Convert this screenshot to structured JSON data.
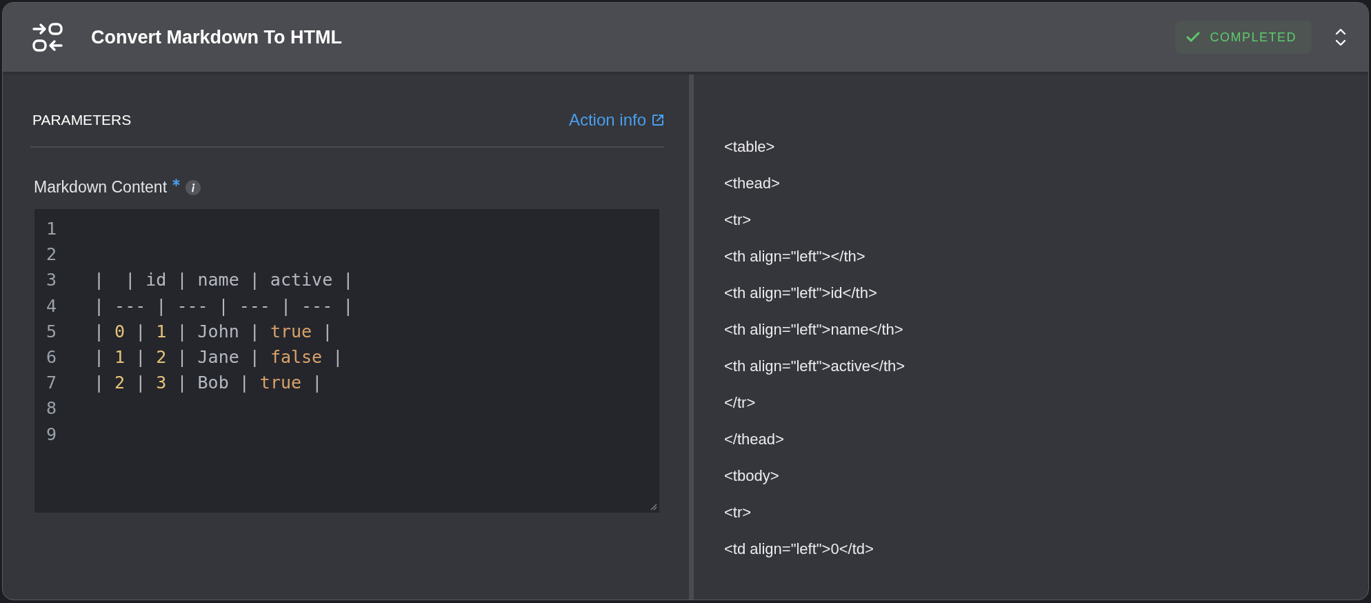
{
  "header": {
    "title": "Convert Markdown To HTML",
    "status": {
      "label": "COMPLETED",
      "kind": "completed"
    }
  },
  "parameters": {
    "heading": "PARAMETERS",
    "link": "Action info",
    "field": {
      "label": "Markdown Content",
      "required": true,
      "lines": [
        {
          "number": "1"
        },
        {
          "number": "2"
        },
        {
          "number": "3",
          "tokens": [
            {
              "kind": "plain",
              "text": "|  | id | name | active |"
            }
          ]
        },
        {
          "number": "4",
          "tokens": [
            {
              "kind": "plain",
              "text": "| --- | --- | --- | --- |"
            }
          ]
        },
        {
          "number": "5",
          "tokens": [
            {
              "kind": "plain",
              "text": "| "
            },
            {
              "kind": "number",
              "text": "0"
            },
            {
              "kind": "plain",
              "text": " | "
            },
            {
              "kind": "number",
              "text": "1"
            },
            {
              "kind": "plain",
              "text": " | John | "
            },
            {
              "kind": "keyword",
              "text": "true"
            },
            {
              "kind": "plain",
              "text": " |"
            }
          ]
        },
        {
          "number": "6",
          "tokens": [
            {
              "kind": "plain",
              "text": "| "
            },
            {
              "kind": "number",
              "text": "1"
            },
            {
              "kind": "plain",
              "text": " | "
            },
            {
              "kind": "number",
              "text": "2"
            },
            {
              "kind": "plain",
              "text": " | Jane | "
            },
            {
              "kind": "keyword",
              "text": "false"
            },
            {
              "kind": "plain",
              "text": " |"
            }
          ]
        },
        {
          "number": "7",
          "tokens": [
            {
              "kind": "plain",
              "text": "| "
            },
            {
              "kind": "number",
              "text": "2"
            },
            {
              "kind": "plain",
              "text": " | "
            },
            {
              "kind": "number",
              "text": "3"
            },
            {
              "kind": "plain",
              "text": " | Bob | "
            },
            {
              "kind": "keyword",
              "text": "true"
            },
            {
              "kind": "plain",
              "text": " |"
            }
          ]
        },
        {
          "number": "8"
        },
        {
          "number": "9"
        }
      ]
    }
  },
  "output": {
    "lines": [
      "<table>",
      "<thead>",
      "<tr>",
      "<th align=\"left\"></th>",
      "<th align=\"left\">id</th>",
      "<th align=\"left\">name</th>",
      "<th align=\"left\">active</th>",
      "</tr>",
      "</thead>",
      "<tbody>",
      "<tr>",
      "<td align=\"left\">0</td>"
    ]
  }
}
